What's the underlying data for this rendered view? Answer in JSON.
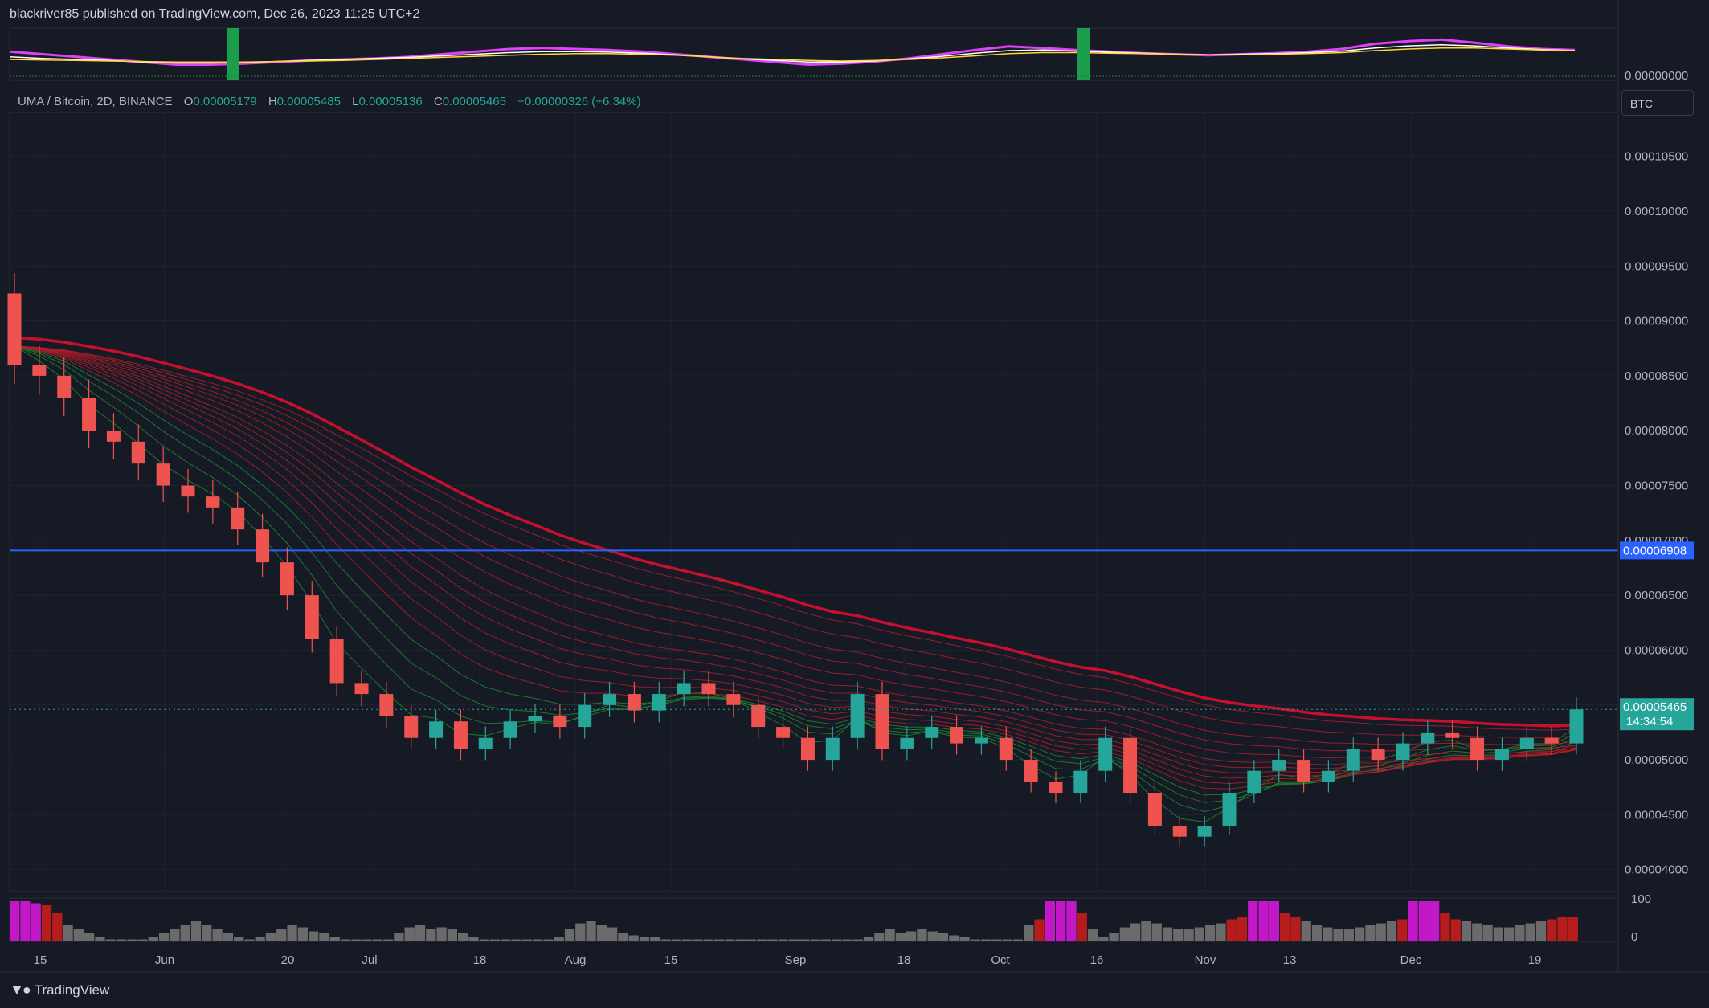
{
  "header": {
    "published": "blackriver85 published on TradingView.com, Dec 26, 2023 11:25 UTC+2"
  },
  "legend": {
    "symbol": "UMA / Bitcoin, 2D, BINANCE",
    "o_label": "O",
    "o": "0.00005179",
    "h_label": "H",
    "h": "0.00005485",
    "l_label": "L",
    "l": "0.00005136",
    "c_label": "C",
    "c": "0.00005465",
    "change": "+0.00000326 (+6.34%)"
  },
  "currency_button": "BTC",
  "brand": "TradingView",
  "colors": {
    "background": "#161a25",
    "up": "#26a69a",
    "down": "#ef5350",
    "ribbon_red": "#c8102e",
    "ribbon_green": "#1b8a2e",
    "hline": "#2962ff",
    "price_badge": "#26a69a"
  },
  "chart_data": [
    {
      "type": "line",
      "name": "oscillator",
      "axis_labels": [
        "0.00000000"
      ],
      "series": [
        {
          "color": "#e040fb",
          "values": [
            0.55,
            0.5,
            0.45,
            0.4,
            0.35,
            0.3,
            0.3,
            0.32,
            0.35,
            0.38,
            0.4,
            0.42,
            0.45,
            0.5,
            0.55,
            0.6,
            0.62,
            0.6,
            0.58,
            0.55,
            0.5,
            0.45,
            0.4,
            0.35,
            0.3,
            0.32,
            0.36,
            0.42,
            0.5,
            0.58,
            0.65,
            0.62,
            0.58,
            0.55,
            0.52,
            0.5,
            0.48,
            0.5,
            0.52,
            0.55,
            0.6,
            0.7,
            0.75,
            0.78,
            0.72,
            0.65,
            0.6,
            0.58
          ]
        },
        {
          "color": "#ffffff",
          "values": [
            0.45,
            0.42,
            0.4,
            0.38,
            0.35,
            0.33,
            0.33,
            0.34,
            0.36,
            0.38,
            0.4,
            0.42,
            0.44,
            0.47,
            0.5,
            0.53,
            0.55,
            0.55,
            0.54,
            0.52,
            0.49,
            0.45,
            0.41,
            0.38,
            0.35,
            0.35,
            0.37,
            0.41,
            0.46,
            0.52,
            0.57,
            0.58,
            0.56,
            0.54,
            0.52,
            0.5,
            0.49,
            0.5,
            0.51,
            0.53,
            0.56,
            0.62,
            0.66,
            0.68,
            0.66,
            0.62,
            0.59,
            0.57
          ]
        },
        {
          "color": "#fdd835",
          "values": [
            0.4,
            0.39,
            0.38,
            0.37,
            0.36,
            0.35,
            0.35,
            0.35,
            0.36,
            0.37,
            0.38,
            0.4,
            0.42,
            0.44,
            0.46,
            0.48,
            0.5,
            0.51,
            0.51,
            0.5,
            0.48,
            0.45,
            0.42,
            0.4,
            0.38,
            0.37,
            0.38,
            0.4,
            0.43,
            0.47,
            0.51,
            0.53,
            0.53,
            0.52,
            0.51,
            0.5,
            0.49,
            0.49,
            0.5,
            0.51,
            0.53,
            0.57,
            0.6,
            0.62,
            0.62,
            0.6,
            0.58,
            0.57
          ]
        }
      ]
    },
    {
      "type": "candlestick",
      "name": "price",
      "y_ticks": [
        "0.00004000",
        "0.00004500",
        "0.00005000",
        "0.00005500",
        "0.00006000",
        "0.00006500",
        "0.00007000",
        "0.00007500",
        "0.00008000",
        "0.00008500",
        "0.00009000",
        "0.00009500",
        "0.00010000",
        "0.00010500"
      ],
      "x_ticks": [
        "15",
        "Jun",
        "20",
        "Jul",
        "18",
        "Aug",
        "15",
        "Sep",
        "18",
        "Oct",
        "16",
        "Nov",
        "13",
        "Dec",
        "19"
      ],
      "hline": {
        "value": 6.908e-05,
        "label": "0.00006908"
      },
      "last_price": {
        "label": "0.00005465",
        "countdown": "14:34:54"
      },
      "close": [
        8.6e-05,
        8.5e-05,
        8.3e-05,
        8e-05,
        7.9e-05,
        7.7e-05,
        7.5e-05,
        7.4e-05,
        7.3e-05,
        7.1e-05,
        6.8e-05,
        6.5e-05,
        6.1e-05,
        5.7e-05,
        5.6e-05,
        5.4e-05,
        5.2e-05,
        5.35e-05,
        5.1e-05,
        5.2e-05,
        5.35e-05,
        5.4e-05,
        5.3e-05,
        5.5e-05,
        5.6e-05,
        5.45e-05,
        5.6e-05,
        5.7e-05,
        5.6e-05,
        5.5e-05,
        5.3e-05,
        5.2e-05,
        5e-05,
        5.2e-05,
        5.6e-05,
        5.1e-05,
        5.2e-05,
        5.3e-05,
        5.15e-05,
        5.2e-05,
        5e-05,
        4.8e-05,
        4.7e-05,
        4.9e-05,
        5.2e-05,
        4.7e-05,
        4.4e-05,
        4.3e-05,
        4.4e-05,
        4.7e-05,
        4.9e-05,
        5e-05,
        4.8e-05,
        4.9e-05,
        5.1e-05,
        5e-05,
        5.15e-05,
        5.25e-05,
        5.2e-05,
        5e-05,
        5.1e-05,
        5.2e-05,
        5.15e-05,
        5.46e-05
      ]
    },
    {
      "type": "bar",
      "name": "volume-oscillator",
      "axis_labels": [
        "100",
        "0"
      ],
      "values": [
        100,
        100,
        95,
        90,
        70,
        40,
        30,
        20,
        10,
        5,
        5,
        5,
        5,
        10,
        20,
        30,
        40,
        50,
        40,
        30,
        20,
        10,
        5,
        10,
        20,
        30,
        40,
        35,
        25,
        20,
        10,
        5,
        5,
        5,
        5,
        5,
        20,
        35,
        40,
        30,
        35,
        30,
        20,
        10,
        5,
        5,
        5,
        5,
        5,
        5,
        5,
        10,
        30,
        45,
        50,
        40,
        35,
        20,
        15,
        10,
        10,
        5,
        5,
        5,
        5,
        5,
        5,
        5,
        5,
        5,
        5,
        5,
        5,
        5,
        5,
        5,
        5,
        5,
        5,
        5,
        10,
        20,
        30,
        20,
        25,
        30,
        25,
        20,
        15,
        10,
        5,
        5,
        5,
        5,
        5,
        40,
        55,
        100,
        100,
        100,
        70,
        30,
        10,
        20,
        35,
        45,
        50,
        45,
        35,
        30,
        30,
        35,
        40,
        45,
        55,
        60,
        100,
        100,
        100,
        70,
        60,
        50,
        40,
        35,
        30,
        30,
        35,
        40,
        45,
        50,
        55,
        100,
        100,
        100,
        70,
        55,
        50,
        45,
        40,
        35,
        35,
        40,
        45,
        50,
        55,
        60,
        60
      ]
    }
  ]
}
